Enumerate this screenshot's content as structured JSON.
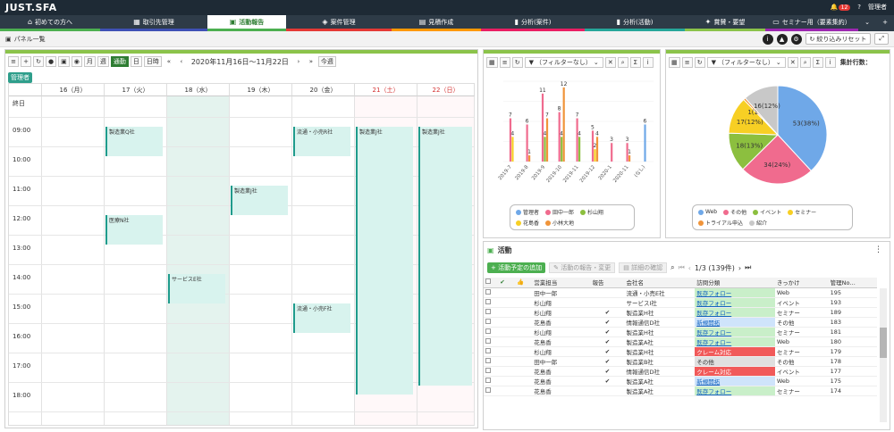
{
  "app": {
    "logo": "JUST.SFA",
    "badge": "12",
    "user": "管理者"
  },
  "nav": [
    "初めての方へ",
    "取引先管理",
    "活動報告",
    "案件管理",
    "見積作成",
    "分析(案件)",
    "分析(活動)",
    "賞賛・要望",
    "セミナー用（要素集約）"
  ],
  "subbar": {
    "panel_list": "パネル一覧",
    "reset": "絞り込みリセット"
  },
  "calendar": {
    "views": [
      "月",
      "週",
      "通勤",
      "日",
      "日時"
    ],
    "range": "2020年11月16日～11月22日",
    "today": "今週",
    "manager": "管理者",
    "days": [
      "16（月）",
      "17（火）",
      "18（水）",
      "19（木）",
      "20（金）",
      "21（土）",
      "22（日）"
    ],
    "allday": "終日",
    "times": [
      "09:00",
      "10:00",
      "11:00",
      "12:00",
      "13:00",
      "14:00",
      "15:00",
      "16:00",
      "17:00",
      "18:00"
    ],
    "events": [
      "製造業Q社",
      "製造業J社",
      "医療N社",
      "サービスE社",
      "流通・小売R社",
      "流通・小売F社",
      "製造業J社",
      "製造業J社"
    ]
  },
  "bar_panel": {
    "filter": "（フィルターなし）",
    "legend": [
      "管理者",
      "田中一郎",
      "杉山翔",
      "花島香",
      "小林大地"
    ]
  },
  "pie_panel": {
    "filter": "（フィルターなし）",
    "total": "集計行数：",
    "legend": [
      "Web",
      "その他",
      "イベント",
      "セミナー",
      "トライアル申込",
      "紹介"
    ]
  },
  "chart_data": [
    {
      "type": "bar",
      "categories": [
        "2019-7",
        "2019-8",
        "2019-9",
        "2019-10",
        "2019-11",
        "2019-12",
        "2020-1",
        "2020-11",
        "(なし)"
      ],
      "series": [
        {
          "name": "管理者",
          "values": [
            null,
            null,
            null,
            null,
            null,
            null,
            null,
            null,
            6
          ]
        },
        {
          "name": "田中一郎",
          "values": [
            7,
            6,
            11,
            8,
            7,
            5,
            3,
            3,
            null
          ]
        },
        {
          "name": "杉山翔",
          "values": [
            null,
            null,
            4,
            4,
            4,
            null,
            null,
            null,
            null
          ]
        },
        {
          "name": "花島香",
          "values": [
            4,
            null,
            null,
            null,
            null,
            2,
            null,
            null,
            null
          ]
        },
        {
          "name": "小林大地",
          "values": [
            null,
            1,
            7,
            12,
            null,
            4,
            null,
            1,
            null
          ]
        }
      ]
    },
    {
      "type": "pie",
      "slices": [
        {
          "label": "Web",
          "value": 53,
          "pct": "38%",
          "color": "#6fa8e8"
        },
        {
          "label": "その他",
          "value": 34,
          "pct": "24%",
          "color": "#f06b8e"
        },
        {
          "label": "イベント",
          "value": 18,
          "pct": "13%",
          "color": "#8cbf3f"
        },
        {
          "label": "セミナー",
          "value": 17,
          "pct": "12%",
          "color": "#f7cf24"
        },
        {
          "label": "トライアル申込",
          "value": 1,
          "pct": "1%",
          "color": "#f0943a"
        },
        {
          "label": "紹介",
          "value": 16,
          "pct": "12%",
          "color": "#c8c8c8"
        }
      ]
    }
  ],
  "activity": {
    "title": "活動",
    "add": "活動予定の追加",
    "report": "活動の報告・変更",
    "detail": "詳細の確認",
    "page": "1/3 (139件)",
    "columns": [
      "営業担当",
      "報告",
      "会社名",
      "訪問分類",
      "きっかけ",
      "管理No…"
    ],
    "rows": [
      [
        "田中一郎",
        "",
        "流通・小売E社",
        "既存フォロー",
        "Web",
        "195"
      ],
      [
        "杉山翔",
        "",
        "サービスI社",
        "既存フォロー",
        "イベント",
        "193"
      ],
      [
        "杉山翔",
        "✔",
        "製造業H社",
        "既存フォロー",
        "セミナー",
        "189"
      ],
      [
        "花島香",
        "✔",
        "情報通信D社",
        "新規開拓",
        "その他",
        "183"
      ],
      [
        "杉山翔",
        "✔",
        "製造業H社",
        "既存フォロー",
        "セミナー",
        "181"
      ],
      [
        "花島香",
        "✔",
        "製造業A社",
        "既存フォロー",
        "Web",
        "180"
      ],
      [
        "杉山翔",
        "✔",
        "製造業H社",
        "クレーム対応",
        "セミナー",
        "179"
      ],
      [
        "田中一郎",
        "✔",
        "製造業B社",
        "その他",
        "その他",
        "178"
      ],
      [
        "花島香",
        "✔",
        "情報通信D社",
        "クレーム対応",
        "イベント",
        "177"
      ],
      [
        "花島香",
        "✔",
        "製造業A社",
        "新規開拓",
        "Web",
        "175"
      ],
      [
        "花島香",
        "",
        "製造業A社",
        "既存フォロー",
        "セミナー",
        "174"
      ]
    ]
  }
}
